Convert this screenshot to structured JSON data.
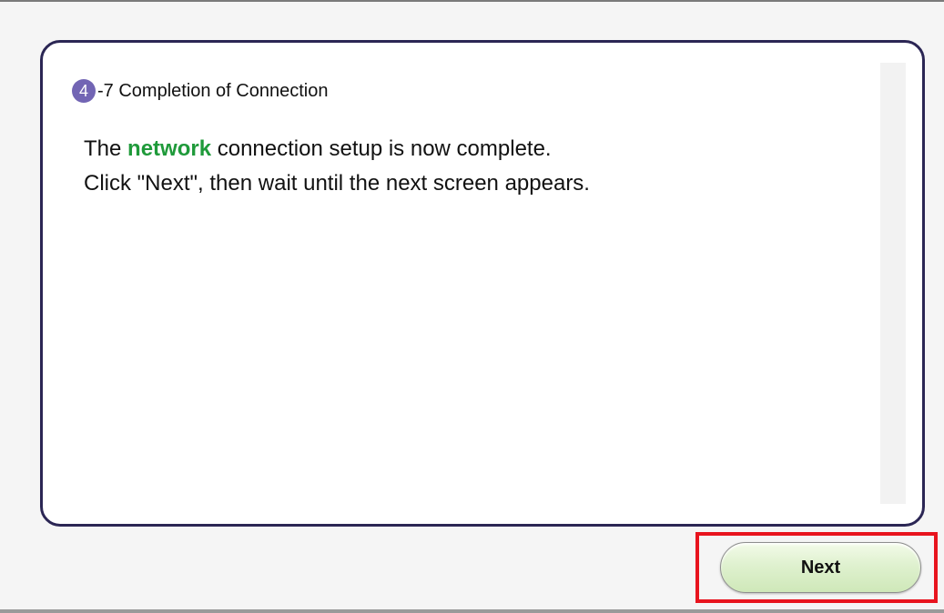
{
  "step": {
    "number": "4",
    "suffix": "-7 Completion of Connection"
  },
  "message": {
    "line1_before": "The ",
    "line1_highlight": "network",
    "line1_after": " connection setup is now complete.",
    "line2": "Click \"Next\", then wait until the next screen appears."
  },
  "buttons": {
    "next_label": "Next"
  },
  "colors": {
    "panel_border": "#2b2654",
    "badge": "#7265b4",
    "highlight_text": "#1f9a3a",
    "emphasis_box": "#e8141e"
  }
}
